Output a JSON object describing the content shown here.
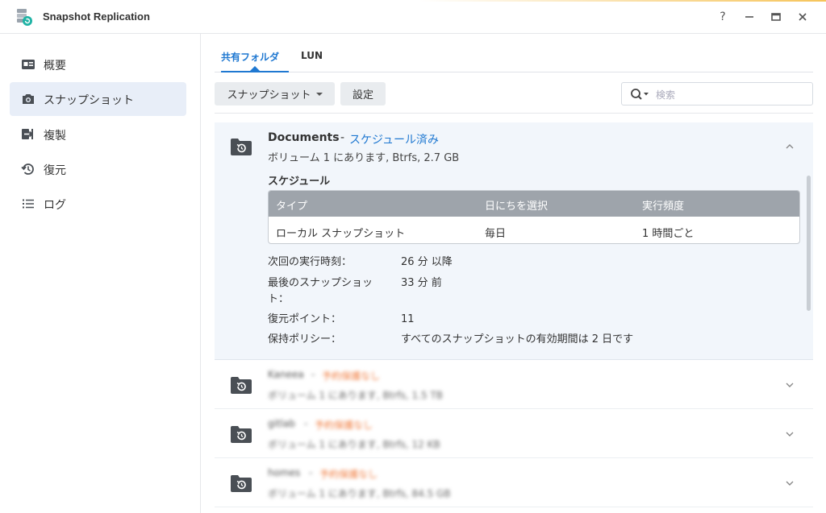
{
  "window": {
    "title": "Snapshot Replication",
    "controls": {
      "help": "?",
      "minimize": "—",
      "maximize": "▭",
      "close": "✕"
    }
  },
  "sidebar": {
    "items": [
      {
        "label": "概要",
        "icon": "overview-icon"
      },
      {
        "label": "スナップショット",
        "icon": "camera-icon",
        "active": true
      },
      {
        "label": "複製",
        "icon": "replication-icon"
      },
      {
        "label": "復元",
        "icon": "restore-icon"
      },
      {
        "label": "ログ",
        "icon": "log-list-icon"
      }
    ]
  },
  "tabs": [
    {
      "label": "共有フォルダ",
      "active": true
    },
    {
      "label": "LUN"
    }
  ],
  "toolbar": {
    "snapshot_button": "スナップショット",
    "settings_button": "設定",
    "search_placeholder": "検索"
  },
  "expanded_folder": {
    "name": "Documents",
    "separator": "-",
    "status": "スケジュール済み",
    "info": "ボリューム 1 にあります, Btrfs, 2.7 GB",
    "schedule_title": "スケジュール",
    "schedule_table": {
      "headers": [
        "タイプ",
        "日にちを選択",
        "実行頻度"
      ],
      "rows": [
        [
          "ローカル スナップショット",
          "毎日",
          "1 時間ごと"
        ]
      ]
    },
    "details": [
      {
        "label": "次回の実行時刻：",
        "value": "26 分 以降"
      },
      {
        "label": "最後のスナップショッ\nト：",
        "value": "33 分 前"
      },
      {
        "label": "復元ポイント：",
        "value": "11"
      },
      {
        "label": "保持ポリシー：",
        "value": "すべてのスナップショットの有効期間は 2 日です"
      }
    ]
  },
  "collapsed_folders": [
    {
      "name": "Kaneea",
      "separator": "-",
      "status": "予約保護なし",
      "info": "ボリューム 1 にあります, Btrfs, 1.5 TB"
    },
    {
      "name": "gitlab",
      "separator": "-",
      "status": "予約保護なし",
      "info": "ボリューム 1 にあります, Btrfs, 12 KB"
    },
    {
      "name": "homes",
      "separator": "-",
      "status": "予約保護なし",
      "info": "ボリューム 1 にあります, Btrfs, 84.5 GB"
    }
  ],
  "colors": {
    "accent": "#1f78d1",
    "warning": "#f07a3c",
    "header_gray": "#9ea4ab",
    "expanded_bg": "#f2f6fb"
  }
}
